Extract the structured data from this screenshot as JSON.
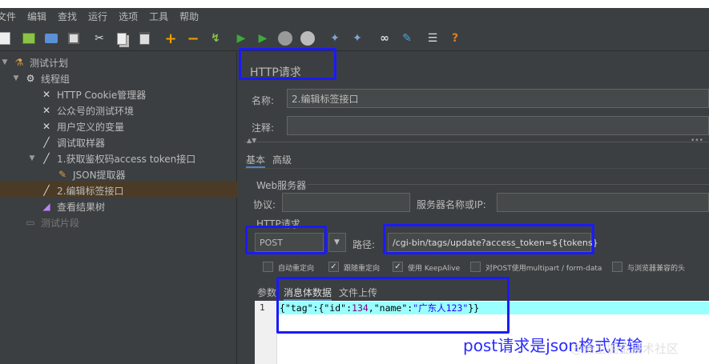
{
  "menu": [
    "文件",
    "编辑",
    "查找",
    "运行",
    "选项",
    "工具",
    "帮助"
  ],
  "tree": {
    "test_plan": "测试计划",
    "thread_group": "线程组",
    "cookie_manager": "HTTP Cookie管理器",
    "test_env": "公众号的测试环境",
    "user_vars": "用户定义的变量",
    "debug_sampler": "调试取样器",
    "token_api": "1.获取鉴权码access token接口",
    "json_extractor": "JSON提取器",
    "edit_tag_api": "2.编辑标签接口",
    "result_tree": "查看结果树",
    "test_fragment": "测试片段"
  },
  "panel": {
    "title": "HTTP请求",
    "name_label": "名称:",
    "name_value": "2.编辑标签接口",
    "comment_label": "注释:",
    "comment_value": "",
    "tabs": [
      "基本",
      "高级"
    ],
    "web_server": "Web服务器",
    "protocol_label": "协议:",
    "server_label": "服务器名称或IP:",
    "http_request": "HTTP请求",
    "method": "POST",
    "path_label": "路径:",
    "path_value": "/cgi-bin/tags/update?access_token=${tokens}",
    "checkboxes": [
      {
        "label": "自动重定向",
        "checked": false
      },
      {
        "label": "跟随重定向",
        "checked": true
      },
      {
        "label": "使用 KeepAlive",
        "checked": true
      },
      {
        "label": "对POST使用multipart / form-data",
        "checked": false
      },
      {
        "label": "与浏览器兼容的头",
        "checked": false
      }
    ],
    "body_tabs": [
      "参数",
      "消息体数据",
      "文件上传"
    ],
    "line_number": "1",
    "code": {
      "p1": "{\"tag\":{\"id\":",
      "num": "134",
      "p2": ",\"name\":",
      "str": "\"广东人123\"",
      "p3": "}}"
    }
  },
  "annotation": "post请求是json格式传输",
  "watermark": "@稀土掘金技术社区",
  "colors": {
    "background": "#3c3f41",
    "selection": "#4b3b26",
    "highlight_box": "#1a1aff",
    "current_line": "#99ffff",
    "code_string": "#2a00ff",
    "code_number": "#7f007f"
  }
}
